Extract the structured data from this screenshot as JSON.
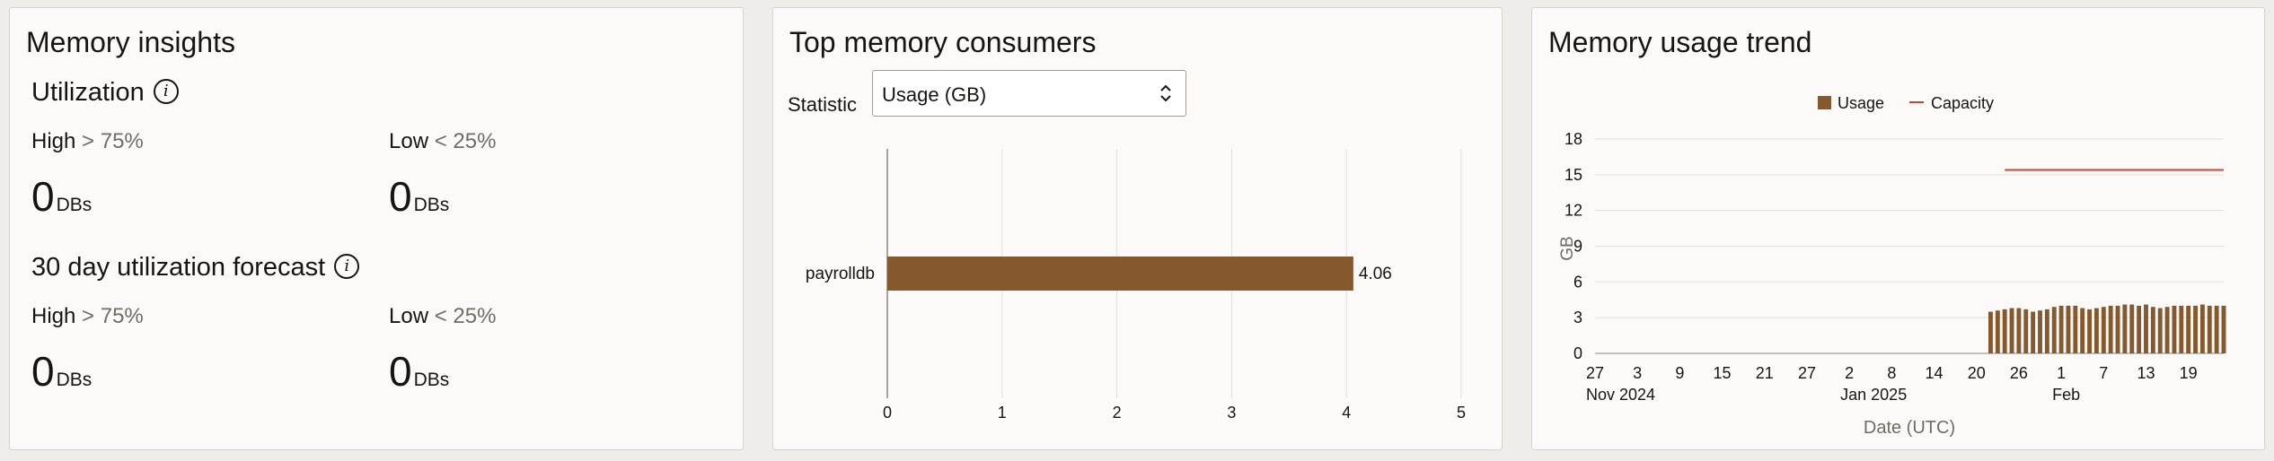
{
  "insights": {
    "title": "Memory insights",
    "utilization": {
      "title": "Utilization",
      "info_icon": "i",
      "high": {
        "label": "High",
        "cmp": "> 75%",
        "count": "0",
        "unit": "DBs"
      },
      "low": {
        "label": "Low",
        "cmp": "< 25%",
        "count": "0",
        "unit": "DBs"
      }
    },
    "forecast": {
      "title": "30 day utilization forecast",
      "info_icon": "i",
      "high": {
        "label": "High",
        "cmp": "> 75%",
        "count": "0",
        "unit": "DBs"
      },
      "low": {
        "label": "Low",
        "cmp": "< 25%",
        "count": "0",
        "unit": "DBs"
      }
    }
  },
  "consumers": {
    "title": "Top memory consumers",
    "statistic_label": "Statistic",
    "statistic_value": "Usage (GB)",
    "chart_data": {
      "type": "bar",
      "orientation": "horizontal",
      "categories": [
        "payrolldb"
      ],
      "values": [
        4.06
      ],
      "value_labels": [
        "4.06"
      ],
      "xlim": [
        0,
        5
      ],
      "ticks": [
        "0",
        "1",
        "2",
        "3",
        "4",
        "5"
      ],
      "grid": true,
      "color": "#86582d"
    }
  },
  "trend": {
    "title": "Memory usage trend",
    "chart_data": {
      "type": "bar",
      "legend": [
        {
          "name": "Usage",
          "marker": "square",
          "color": "#86582d"
        },
        {
          "name": "Capacity",
          "marker": "line",
          "color": "#c74634"
        }
      ],
      "legend_position": "top-center",
      "ylabel": "GB",
      "xlabel": "Date (UTC)",
      "ylim": [
        0,
        18
      ],
      "yticks": [
        "0",
        "3",
        "6",
        "9",
        "12",
        "15",
        "18"
      ],
      "xticks": [
        "27",
        "3",
        "9",
        "15",
        "21",
        "27",
        "2",
        "8",
        "14",
        "20",
        "26",
        "1",
        "7",
        "13",
        "19"
      ],
      "xtick_groups": [
        "Nov 2024",
        "Jan 2025",
        "Feb"
      ],
      "x_start": "2024-11-27",
      "x_end": "2025-02-24",
      "series": [
        {
          "name": "Capacity",
          "type": "line",
          "x": [
            "2025-01-24",
            "2025-02-24"
          ],
          "values": [
            15.4,
            15.4
          ]
        },
        {
          "name": "Usage",
          "type": "bar",
          "x": [
            "2025-01-22",
            "2025-01-23",
            "2025-01-24",
            "2025-01-25",
            "2025-01-26",
            "2025-01-27",
            "2025-01-28",
            "2025-01-29",
            "2025-01-30",
            "2025-01-31",
            "2025-02-01",
            "2025-02-02",
            "2025-02-03",
            "2025-02-04",
            "2025-02-05",
            "2025-02-06",
            "2025-02-07",
            "2025-02-08",
            "2025-02-09",
            "2025-02-10",
            "2025-02-11",
            "2025-02-12",
            "2025-02-13",
            "2025-02-14",
            "2025-02-15",
            "2025-02-16",
            "2025-02-17",
            "2025-02-18",
            "2025-02-19",
            "2025-02-20",
            "2025-02-21",
            "2025-02-22",
            "2025-02-23",
            "2025-02-24"
          ],
          "values": [
            3.5,
            3.6,
            3.7,
            3.8,
            3.8,
            3.7,
            3.5,
            3.6,
            3.7,
            3.9,
            4.0,
            4.0,
            4.0,
            3.8,
            3.7,
            3.8,
            3.9,
            4.0,
            4.0,
            4.1,
            4.1,
            4.0,
            4.1,
            3.9,
            3.8,
            3.9,
            4.0,
            4.0,
            4.0,
            4.0,
            4.1,
            4.0,
            4.0,
            4.0
          ]
        }
      ]
    }
  }
}
